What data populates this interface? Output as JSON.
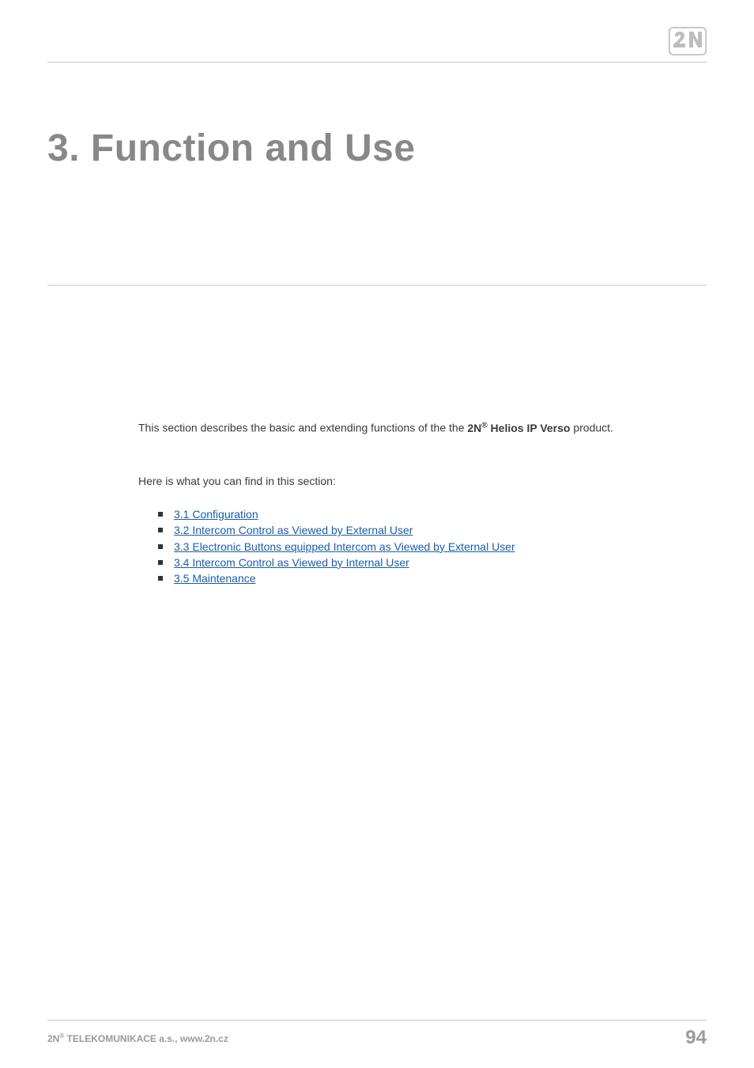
{
  "header": {
    "logo_name": "2N"
  },
  "chapter": {
    "title": "3. Function and Use"
  },
  "body": {
    "intro_prefix": "This section describes the basic and extending functions of the the ",
    "product_brand": "2N",
    "product_reg": "®",
    "product_name": " Helios IP Verso",
    "intro_suffix": " product.",
    "lead_in": "Here is what you can find in this section:",
    "toc": [
      {
        "label": "3.1 Configuration"
      },
      {
        "label": "3.2 Intercom Control as Viewed by External User"
      },
      {
        "label": "3.3 Electronic Buttons equipped Intercom as Viewed by External User"
      },
      {
        "label": "3.4 Intercom Control as Viewed by Internal User"
      },
      {
        "label": "3.5 Maintenance"
      }
    ]
  },
  "footer": {
    "company_prefix": "2N",
    "company_reg": "®",
    "company_suffix": " TELEKOMUNIKACE a.s., www.2n.cz",
    "page_number": "94"
  }
}
